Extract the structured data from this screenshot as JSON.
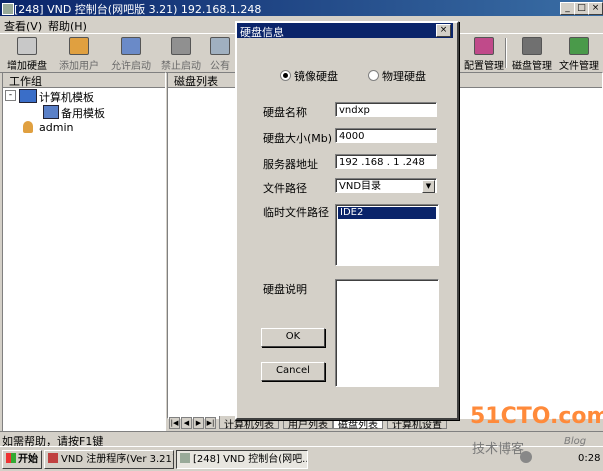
{
  "window": {
    "title": "[248] VND 控制台(网吧版 3.21) 192.168.1.248"
  },
  "menu": {
    "items": [
      "查看(V)",
      "帮助(H)"
    ]
  },
  "toolbar": {
    "buttons": [
      "增加硬盘",
      "添加用户",
      "允许启动",
      "禁止启动",
      "公有",
      "配置管理",
      "磁盘管理",
      "文件管理"
    ]
  },
  "left_panel": {
    "header": "工作组",
    "tree": {
      "root": "计算机模板",
      "child": "备用模板",
      "user": "admin"
    }
  },
  "right_panel": {
    "header": "磁盘列表"
  },
  "tabs": [
    "计算机列表",
    "用户列表",
    "磁盘列表",
    "计算机设置"
  ],
  "status": {
    "help": "如需帮助，请按F1键"
  },
  "taskbar": {
    "start": "开始",
    "tasks": [
      "VND 注册程序(Ver 3.21)",
      "[248] VND 控制台(网吧..."
    ],
    "clock": "0:28"
  },
  "dialog": {
    "title": "硬盘信息",
    "radio_image": "镜像硬盘",
    "radio_physical": "物理硬盘",
    "name_label": "硬盘名称",
    "name_value": "vndxp",
    "size_label": "硬盘大小(Mb)",
    "size_value": "4000",
    "server_label": "服务器地址",
    "server_value": "192 .168 . 1 .248",
    "path_label": "文件路径",
    "path_value": "VND目录",
    "temp_label": "临时文件路径",
    "temp_selected": "IDE2",
    "desc_label": "硬盘说明",
    "ok": "OK",
    "cancel": "Cancel"
  },
  "watermark": {
    "line1": "51CTO.com",
    "line2": "技术博客",
    "line3": "Blog"
  },
  "colors": {
    "titlebar": "#0a246a",
    "face": "#d4d0c8",
    "selection": "#0a246a"
  }
}
